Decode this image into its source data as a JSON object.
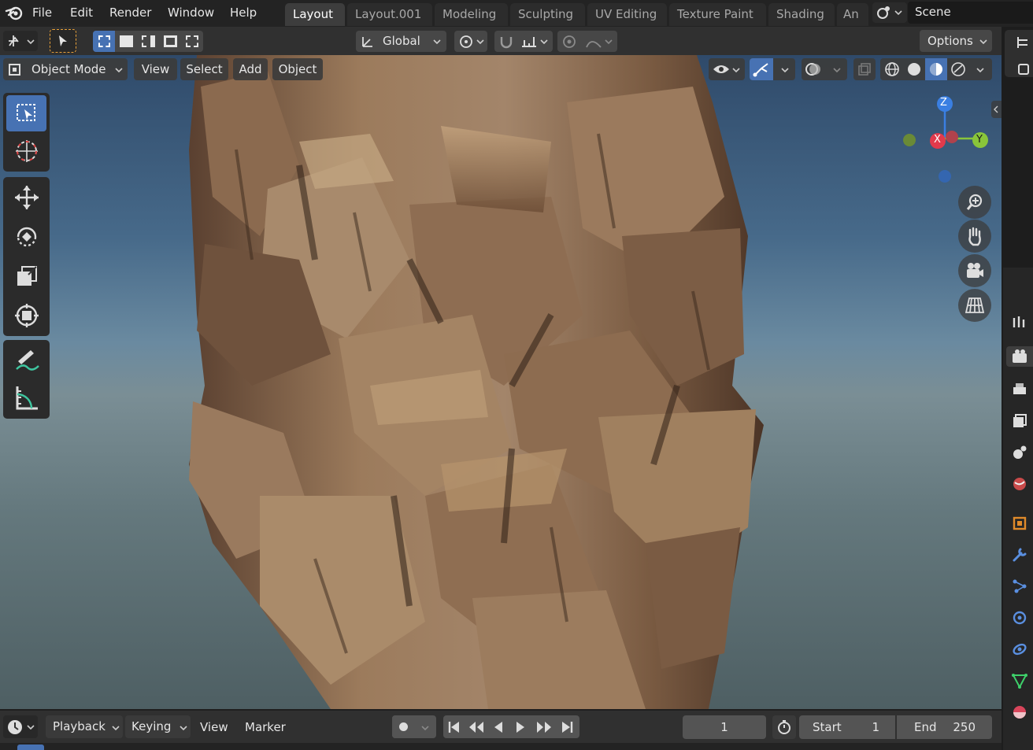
{
  "menu": {
    "file": "File",
    "edit": "Edit",
    "render": "Render",
    "window": "Window",
    "help": "Help"
  },
  "workspaces": [
    "Layout",
    "Layout.001",
    "Modeling",
    "Sculpting",
    "UV Editing",
    "Texture Paint",
    "Shading",
    "An"
  ],
  "active_workspace": "Layout",
  "scene": {
    "name": "Scene"
  },
  "tool_header": {
    "orientation": "Global",
    "options_label": "Options"
  },
  "viewport_header": {
    "mode": "Object Mode",
    "view": "View",
    "select": "Select",
    "add": "Add",
    "object": "Object"
  },
  "gizmo": {
    "z": "Z",
    "x": "X",
    "y": "Y"
  },
  "timeline": {
    "playback": "Playback",
    "keying": "Keying",
    "view": "View",
    "marker": "Marker",
    "current_frame": "1",
    "start_label": "Start",
    "start_value": "1",
    "end_label": "End",
    "end_value": "250"
  },
  "colors": {
    "accent": "#4772b3",
    "axis_x": "#e23a4c",
    "axis_y": "#89c53a",
    "axis_z": "#3a7fe2"
  }
}
